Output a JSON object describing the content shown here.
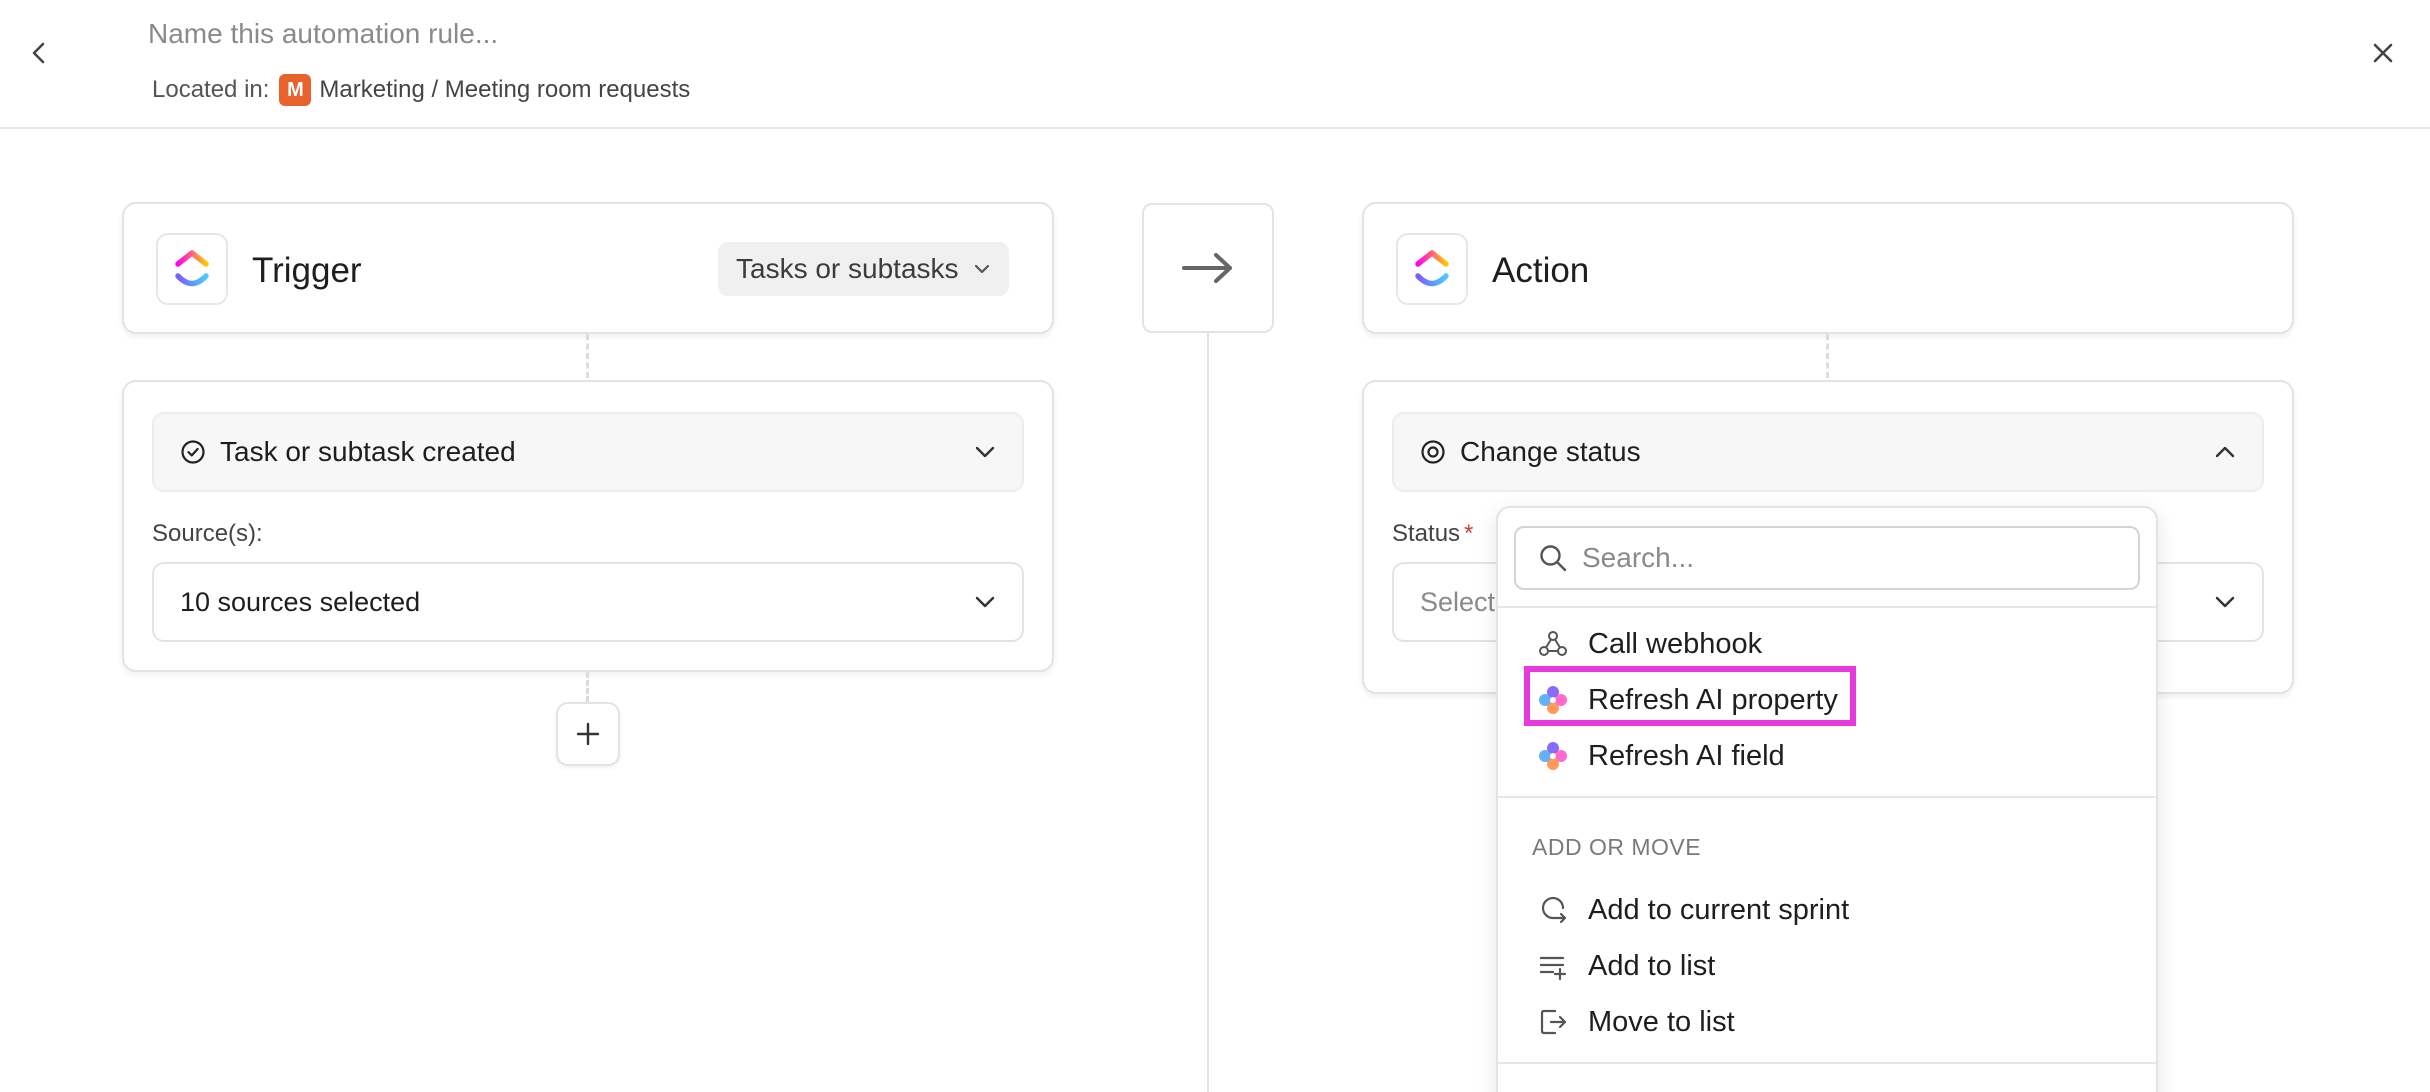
{
  "header": {
    "rule_name_placeholder": "Name this automation rule...",
    "located_in_label": "Located in:",
    "space_badge": "M",
    "location_path": "Marketing / Meeting room requests"
  },
  "trigger": {
    "title": "Trigger",
    "type_pill": "Tasks or subtasks",
    "event_label": "Task or subtask created",
    "source_label": "Source(s):",
    "source_value": "10 sources selected"
  },
  "action": {
    "title": "Action",
    "action_label": "Change status",
    "status_label": "Status",
    "required_mark": "*",
    "status_placeholder": "Select"
  },
  "dropdown": {
    "search_placeholder": "Search...",
    "items_top": [
      {
        "label": "Call webhook",
        "icon": "webhook-icon"
      },
      {
        "label": "Refresh AI property",
        "icon": "ai-sparkle-icon"
      },
      {
        "label": "Refresh AI field",
        "icon": "ai-sparkle-icon"
      }
    ],
    "section_heading": "ADD OR MOVE",
    "items_add_move": [
      {
        "label": "Add to current sprint",
        "icon": "sprint-icon"
      },
      {
        "label": "Add to list",
        "icon": "list-add-icon"
      },
      {
        "label": "Move to list",
        "icon": "move-to-list-icon"
      }
    ]
  },
  "colors": {
    "accent_highlight": "#e83ad8",
    "space_badge": "#e8622b",
    "required": "#d23b3b"
  }
}
